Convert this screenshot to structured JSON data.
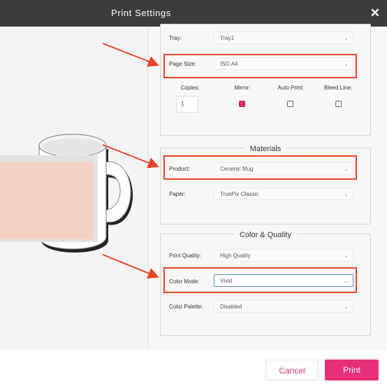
{
  "window": {
    "title": "Print Settings",
    "close_glyph": "✕"
  },
  "printer": {
    "tray": {
      "label": "Tray:",
      "value": "Tray1"
    },
    "page_size": {
      "label": "Page Size:",
      "value": "ISO A4"
    },
    "copies": {
      "label": "Copies:",
      "value": "1"
    },
    "mirror": {
      "label": "Mirror:",
      "checked": true
    },
    "auto_print": {
      "label": "Auto Print:",
      "checked": false
    },
    "bleed_line": {
      "label": "Bleed Line:",
      "checked": false
    }
  },
  "materials": {
    "heading": "Materials",
    "product": {
      "label": "Product:",
      "value": "Ceramic Mug"
    },
    "paper": {
      "label": "Paper:",
      "value": "TruePix Classic"
    }
  },
  "color_quality": {
    "heading": "Color & Quality",
    "print_quality": {
      "label": "Print Quality:",
      "value": "High Quality"
    },
    "color_mode": {
      "label": "Color Mode:",
      "value": "Vivid"
    },
    "color_palette": {
      "label": "Color Palette:",
      "value": "Disabled"
    }
  },
  "actions": {
    "cancel_label": "Cancel",
    "print_label": "Print"
  },
  "icons": {
    "dropdown": "chevron-down-icon",
    "close": "close-icon",
    "preview": "mug-preview"
  },
  "colors": {
    "title_bar": "#3c3c3c",
    "accent_pink": "#e8307a",
    "highlight_red": "#e8442a",
    "mug_print_area": "#f3d2c5",
    "focus_blue": "#4a90d9"
  }
}
